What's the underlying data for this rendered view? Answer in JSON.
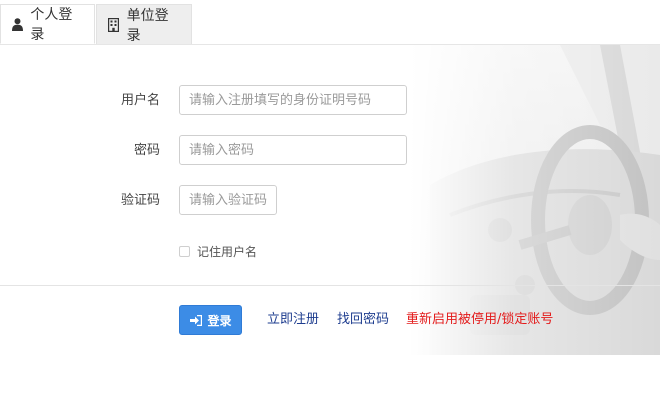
{
  "tabs": [
    {
      "label": "个人登录",
      "icon": "user-icon",
      "active": true
    },
    {
      "label": "单位登录",
      "icon": "building-icon",
      "active": false
    }
  ],
  "form": {
    "username": {
      "label": "用户名",
      "placeholder": "请输入注册填写的身份证明号码",
      "value": ""
    },
    "password": {
      "label": "密码",
      "placeholder": "请输入密码",
      "value": ""
    },
    "captcha": {
      "label": "验证码",
      "placeholder": "请输入验证码",
      "value": ""
    },
    "remember": {
      "label": "记住用户名",
      "checked": false
    }
  },
  "actions": {
    "login_label": "登录",
    "login_icon": "sign-in-icon",
    "register_label": "立即注册",
    "recover_label": "找回密码",
    "reactivate_label": "重新启用被停用/锁定账号"
  },
  "colors": {
    "primary": "#3c8ce6",
    "link": "#1e3d8f",
    "warning_link": "#e31b1b",
    "tab_inactive_bg": "#eeeeee"
  }
}
